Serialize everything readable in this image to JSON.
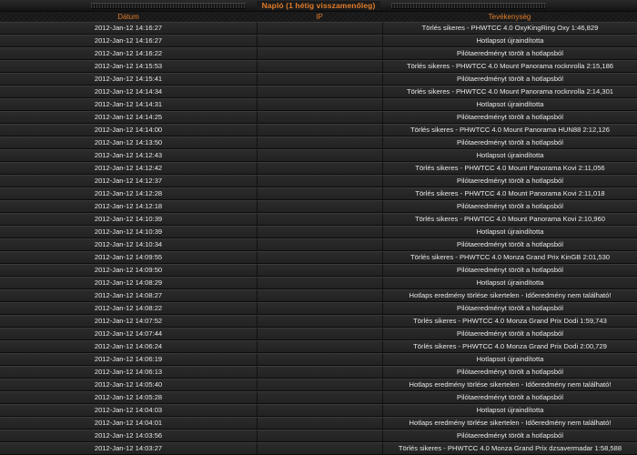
{
  "title": "Napló (1 hétig visszamenőleg)",
  "columns": {
    "date": "Dátum",
    "ip": "IP",
    "activity": "Tevékenység"
  },
  "rows": [
    {
      "date": "2012-Jan-12 14:16:27",
      "ip": "",
      "activity": "Törlés sikeres - PHWTCC 4.0 OxyKingRing Oxy 1:46,829"
    },
    {
      "date": "2012-Jan-12 14:16:27",
      "ip": "",
      "activity": "Hotlapsot újraindította"
    },
    {
      "date": "2012-Jan-12 14:16:22",
      "ip": "",
      "activity": "Pilótaeredményt törölt a hotlapsból"
    },
    {
      "date": "2012-Jan-12 14:15:53",
      "ip": "",
      "activity": "Törlés sikeres - PHWTCC 4.0 Mount Panorama rocknrolla 2:15,186"
    },
    {
      "date": "2012-Jan-12 14:15:41",
      "ip": "",
      "activity": "Pilótaeredményt törölt a hotlapsból"
    },
    {
      "date": "2012-Jan-12 14:14:34",
      "ip": "",
      "activity": "Törlés sikeres - PHWTCC 4.0 Mount Panorama rocknrolla 2:14,301"
    },
    {
      "date": "2012-Jan-12 14:14:31",
      "ip": "",
      "activity": "Hotlapsot újraindította"
    },
    {
      "date": "2012-Jan-12 14:14:25",
      "ip": "",
      "activity": "Pilótaeredményt törölt a hotlapsból"
    },
    {
      "date": "2012-Jan-12 14:14:00",
      "ip": "",
      "activity": "Törlés sikeres - PHWTCC 4.0 Mount Panorama HUN88 2:12,126"
    },
    {
      "date": "2012-Jan-12 14:13:50",
      "ip": "",
      "activity": "Pilótaeredményt törölt a hotlapsból"
    },
    {
      "date": "2012-Jan-12 14:12:43",
      "ip": "",
      "activity": "Hotlapsot újraindította"
    },
    {
      "date": "2012-Jan-12 14:12:42",
      "ip": "",
      "activity": "Törlés sikeres - PHWTCC 4.0 Mount Panorama Kovi 2:11,056"
    },
    {
      "date": "2012-Jan-12 14:12:37",
      "ip": "",
      "activity": "Pilótaeredményt törölt a hotlapsból"
    },
    {
      "date": "2012-Jan-12 14:12:28",
      "ip": "",
      "activity": "Törlés sikeres - PHWTCC 4.0 Mount Panorama Kovi 2:11,018"
    },
    {
      "date": "2012-Jan-12 14:12:18",
      "ip": "",
      "activity": "Pilótaeredményt törölt a hotlapsból"
    },
    {
      "date": "2012-Jan-12 14:10:39",
      "ip": "",
      "activity": "Törlés sikeres - PHWTCC 4.0 Mount Panorama Kovi 2:10,960"
    },
    {
      "date": "2012-Jan-12 14:10:39",
      "ip": "",
      "activity": "Hotlapsot újraindította"
    },
    {
      "date": "2012-Jan-12 14:10:34",
      "ip": "",
      "activity": "Pilótaeredményt törölt a hotlapsból"
    },
    {
      "date": "2012-Jan-12 14:09:55",
      "ip": "",
      "activity": "Törlés sikeres - PHWTCC 4.0 Monza Grand Prix KinGB 2:01,530"
    },
    {
      "date": "2012-Jan-12 14:09:50",
      "ip": "",
      "activity": "Pilótaeredményt törölt a hotlapsból"
    },
    {
      "date": "2012-Jan-12 14:08:29",
      "ip": "",
      "activity": "Hotlapsot újraindította"
    },
    {
      "date": "2012-Jan-12 14:08:27",
      "ip": "",
      "activity": "Hotlaps eredmény törlése sikertelen - Időeredmény nem található!"
    },
    {
      "date": "2012-Jan-12 14:08:22",
      "ip": "",
      "activity": "Pilótaeredményt törölt a hotlapsból"
    },
    {
      "date": "2012-Jan-12 14:07:52",
      "ip": "",
      "activity": "Törlés sikeres - PHWTCC 4.0 Monza Grand Prix Dodi 1:59,743"
    },
    {
      "date": "2012-Jan-12 14:07:44",
      "ip": "",
      "activity": "Pilótaeredményt törölt a hotlapsból"
    },
    {
      "date": "2012-Jan-12 14:06:24",
      "ip": "",
      "activity": "Törlés sikeres - PHWTCC 4.0 Monza Grand Prix Dodi 2:00,729"
    },
    {
      "date": "2012-Jan-12 14:06:19",
      "ip": "",
      "activity": "Hotlapsot újraindította"
    },
    {
      "date": "2012-Jan-12 14:06:13",
      "ip": "",
      "activity": "Pilótaeredményt törölt a hotlapsból"
    },
    {
      "date": "2012-Jan-12 14:05:40",
      "ip": "",
      "activity": "Hotlaps eredmény törlése sikertelen - Időeredmény nem található!"
    },
    {
      "date": "2012-Jan-12 14:05:28",
      "ip": "",
      "activity": "Pilótaeredményt törölt a hotlapsból"
    },
    {
      "date": "2012-Jan-12 14:04:03",
      "ip": "",
      "activity": "Hotlapsot újraindította"
    },
    {
      "date": "2012-Jan-12 14:04:01",
      "ip": "",
      "activity": "Hotlaps eredmény törlése sikertelen - Időeredmény nem található!"
    },
    {
      "date": "2012-Jan-12 14:03:56",
      "ip": "",
      "activity": "Pilótaeredményt törölt a hotlapsból"
    },
    {
      "date": "2012-Jan-12 14:03:27",
      "ip": "",
      "activity": "Törlés sikeres - PHWTCC 4.0 Monza Grand Prix dzsavermadar 1:58,588"
    }
  ]
}
